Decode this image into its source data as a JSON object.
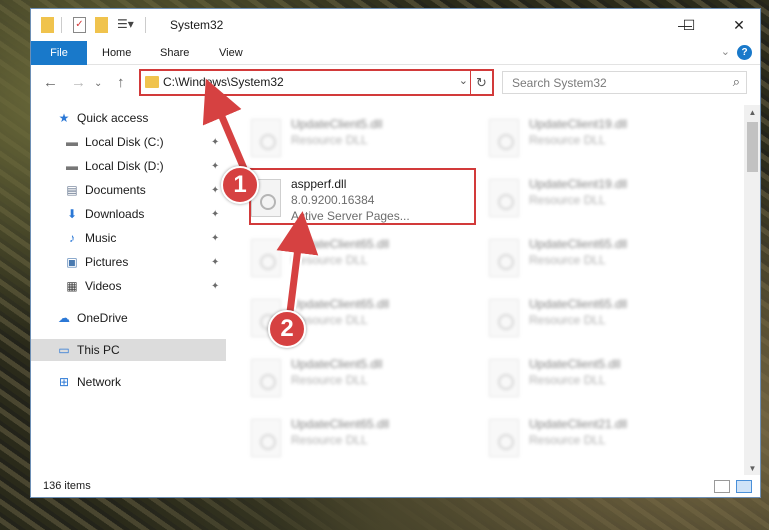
{
  "window": {
    "title": "System32",
    "controls": {
      "minimize": "—",
      "maximize": "☐",
      "close": "✕"
    }
  },
  "ribbon": {
    "file": "File",
    "tabs": [
      "Home",
      "Share",
      "View"
    ],
    "help": "?"
  },
  "nav": {
    "back_icon": "←",
    "forward_icon": "→",
    "up_icon": "↑",
    "address": "C:\\Windows\\System32",
    "dropdown_icon": "⌄",
    "refresh_icon": "↻",
    "search_placeholder": "Search System32"
  },
  "sidebar": {
    "items": [
      {
        "label": "Quick access",
        "icon": "star-icon",
        "glyph": "★"
      },
      {
        "label": "Local Disk (C:)",
        "icon": "drive-icon",
        "glyph": "▬"
      },
      {
        "label": "Local Disk (D:)",
        "icon": "drive-icon",
        "glyph": "▬"
      },
      {
        "label": "Documents",
        "icon": "documents-icon",
        "glyph": "▤"
      },
      {
        "label": "Downloads",
        "icon": "downloads-icon",
        "glyph": "⬇"
      },
      {
        "label": "Music",
        "icon": "music-icon",
        "glyph": "♪"
      },
      {
        "label": "Pictures",
        "icon": "pictures-icon",
        "glyph": "▣"
      },
      {
        "label": "Videos",
        "icon": "videos-icon",
        "glyph": "▦"
      },
      {
        "label": "OneDrive",
        "icon": "cloud-icon",
        "glyph": "☁"
      },
      {
        "label": "This PC",
        "icon": "computer-icon",
        "glyph": "▭"
      },
      {
        "label": "Network",
        "icon": "network-icon",
        "glyph": "⊞"
      }
    ],
    "pin_glyph": "📌"
  },
  "files": {
    "highlighted": {
      "name": "aspperf.dll",
      "version": "8.0.9200.16384",
      "description": "Active Server Pages..."
    },
    "others": [
      {
        "name": "UpdateClient5.dll",
        "type": "Resource DLL"
      },
      {
        "name": "UpdateClient19.dll",
        "type": "Resource DLL"
      },
      {
        "name": "UpdateClient19.dll",
        "type": "Resource DLL"
      },
      {
        "name": "UpdateClient65.dll",
        "type": "Resource DLL"
      },
      {
        "name": "UpdateClient65.dll",
        "type": "Resource DLL"
      },
      {
        "name": "UpdateClient65.dll",
        "type": "Resource DLL"
      },
      {
        "name": "UpdateClient65.dll",
        "type": "Resource DLL"
      },
      {
        "name": "UpdateClient5.dll",
        "type": "Resource DLL"
      },
      {
        "name": "UpdateClient5.dll",
        "type": "Resource DLL"
      },
      {
        "name": "UpdateClient65.dll",
        "type": "Resource DLL"
      },
      {
        "name": "UpdateClient21.dll",
        "type": "Resource DLL"
      }
    ]
  },
  "status": {
    "item_count": "136 items"
  },
  "annotations": {
    "step1": "1",
    "step2": "2",
    "color": "#d64141"
  }
}
